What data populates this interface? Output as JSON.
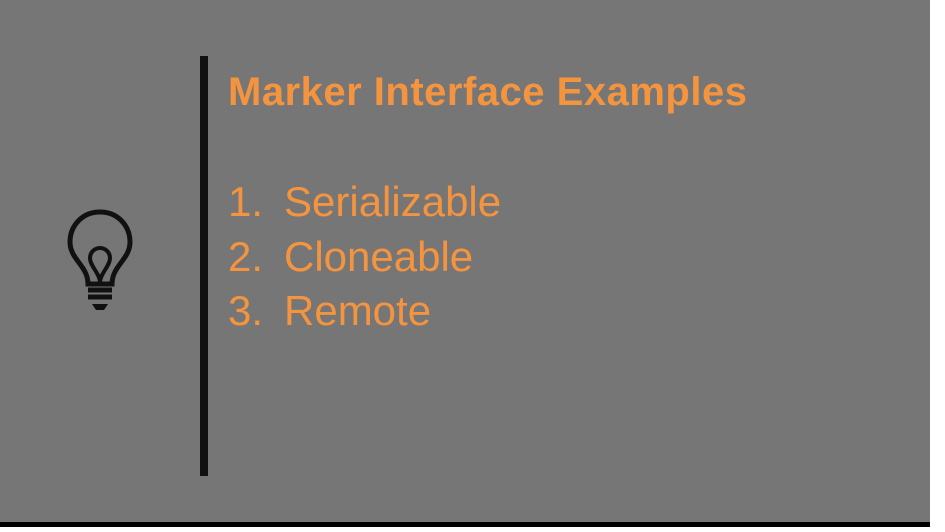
{
  "slide": {
    "title": "Marker Interface Examples",
    "items": [
      {
        "num": "1.",
        "text": "Serializable"
      },
      {
        "num": "2.",
        "text": "Cloneable"
      },
      {
        "num": "3.",
        "text": "Remote"
      }
    ]
  },
  "colors": {
    "background": "#767676",
    "accent": "#f5943f",
    "stroke": "#111"
  }
}
